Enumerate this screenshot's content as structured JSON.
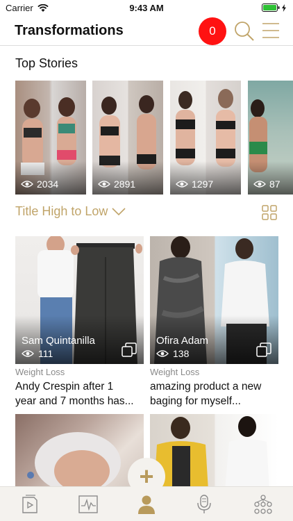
{
  "status_bar": {
    "carrier": "Carrier",
    "time": "9:43 AM"
  },
  "header": {
    "title": "Transformations",
    "notification_count": "0"
  },
  "top_stories": {
    "title": "Top Stories",
    "items": [
      {
        "views": "2034"
      },
      {
        "views": "2891"
      },
      {
        "views": "1297"
      },
      {
        "views": "87"
      }
    ]
  },
  "sort": {
    "label": "Title High to Low"
  },
  "posts": [
    {
      "author": "Sam Quintanilla",
      "views": "111",
      "category": "Weight Loss",
      "title_line1": "Andy Crespin after 1",
      "title_line2": "year and 7 months has..."
    },
    {
      "author": "Ofira Adam",
      "views": "138",
      "category": "Weight Loss",
      "title_line1": "amazing product a new",
      "title_line2": "baging for myself..."
    }
  ],
  "fab": {
    "label": "+"
  },
  "colors": {
    "accent": "#c0a469",
    "badge": "#ff1212",
    "tabbar": "#f4f2ee"
  },
  "tabbar": {
    "items": [
      {
        "icon": "video-doc-icon"
      },
      {
        "icon": "pulse-chart-icon"
      },
      {
        "icon": "person-icon",
        "active": true
      },
      {
        "icon": "microphone-icon"
      },
      {
        "icon": "network-icon"
      }
    ]
  }
}
